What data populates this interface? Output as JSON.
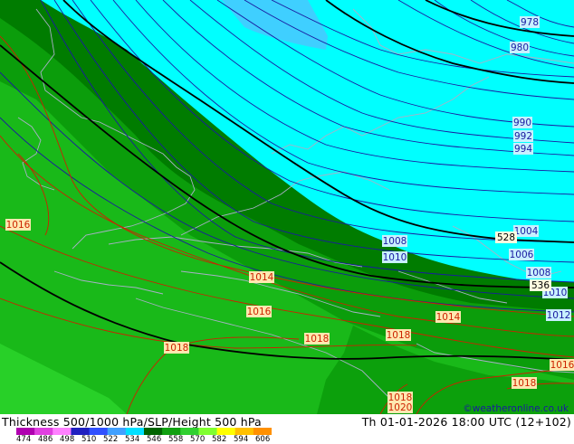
{
  "map": {
    "title": "Thickness 500/1000 hPa/SLP/Height 500 hPa",
    "valid_time": "Th 01-01-2026 18:00 UTC (12+102)",
    "credit": "©weatheronline.co.uk",
    "slp_labels": [
      "978",
      "980",
      "990",
      "992",
      "994",
      "1004",
      "1006",
      "1008",
      "1008",
      "1010",
      "1010",
      "1012",
      "1014",
      "1014",
      "1016",
      "1016",
      "1018",
      "1018",
      "1018",
      "1018",
      "1016",
      "1018",
      "1020"
    ],
    "thickness_labels": [
      "528",
      "536"
    ],
    "colorbar": {
      "ticks": [
        "474",
        "486",
        "498",
        "510",
        "522",
        "534",
        "546",
        "558",
        "570",
        "582",
        "594",
        "606"
      ],
      "colors": [
        "#b000b0",
        "#e040e0",
        "#ff80ff",
        "#2020c0",
        "#3050ff",
        "#40a0ff",
        "#00e0ff",
        "#006400",
        "#10a010",
        "#30d030",
        "#80ff30",
        "#ffff00",
        "#ffc000",
        "#ff9000"
      ]
    },
    "colors": {
      "band_522": "#3fcfff",
      "band_528": "#00ffff",
      "band_534": "#007c00",
      "band_540": "#0b9d0b",
      "band_546": "#19b919",
      "band_552": "#28d028",
      "coast": "#a9b0c8",
      "slp_low": "#1a1aa0",
      "slp_high": "#cc2200"
    }
  }
}
